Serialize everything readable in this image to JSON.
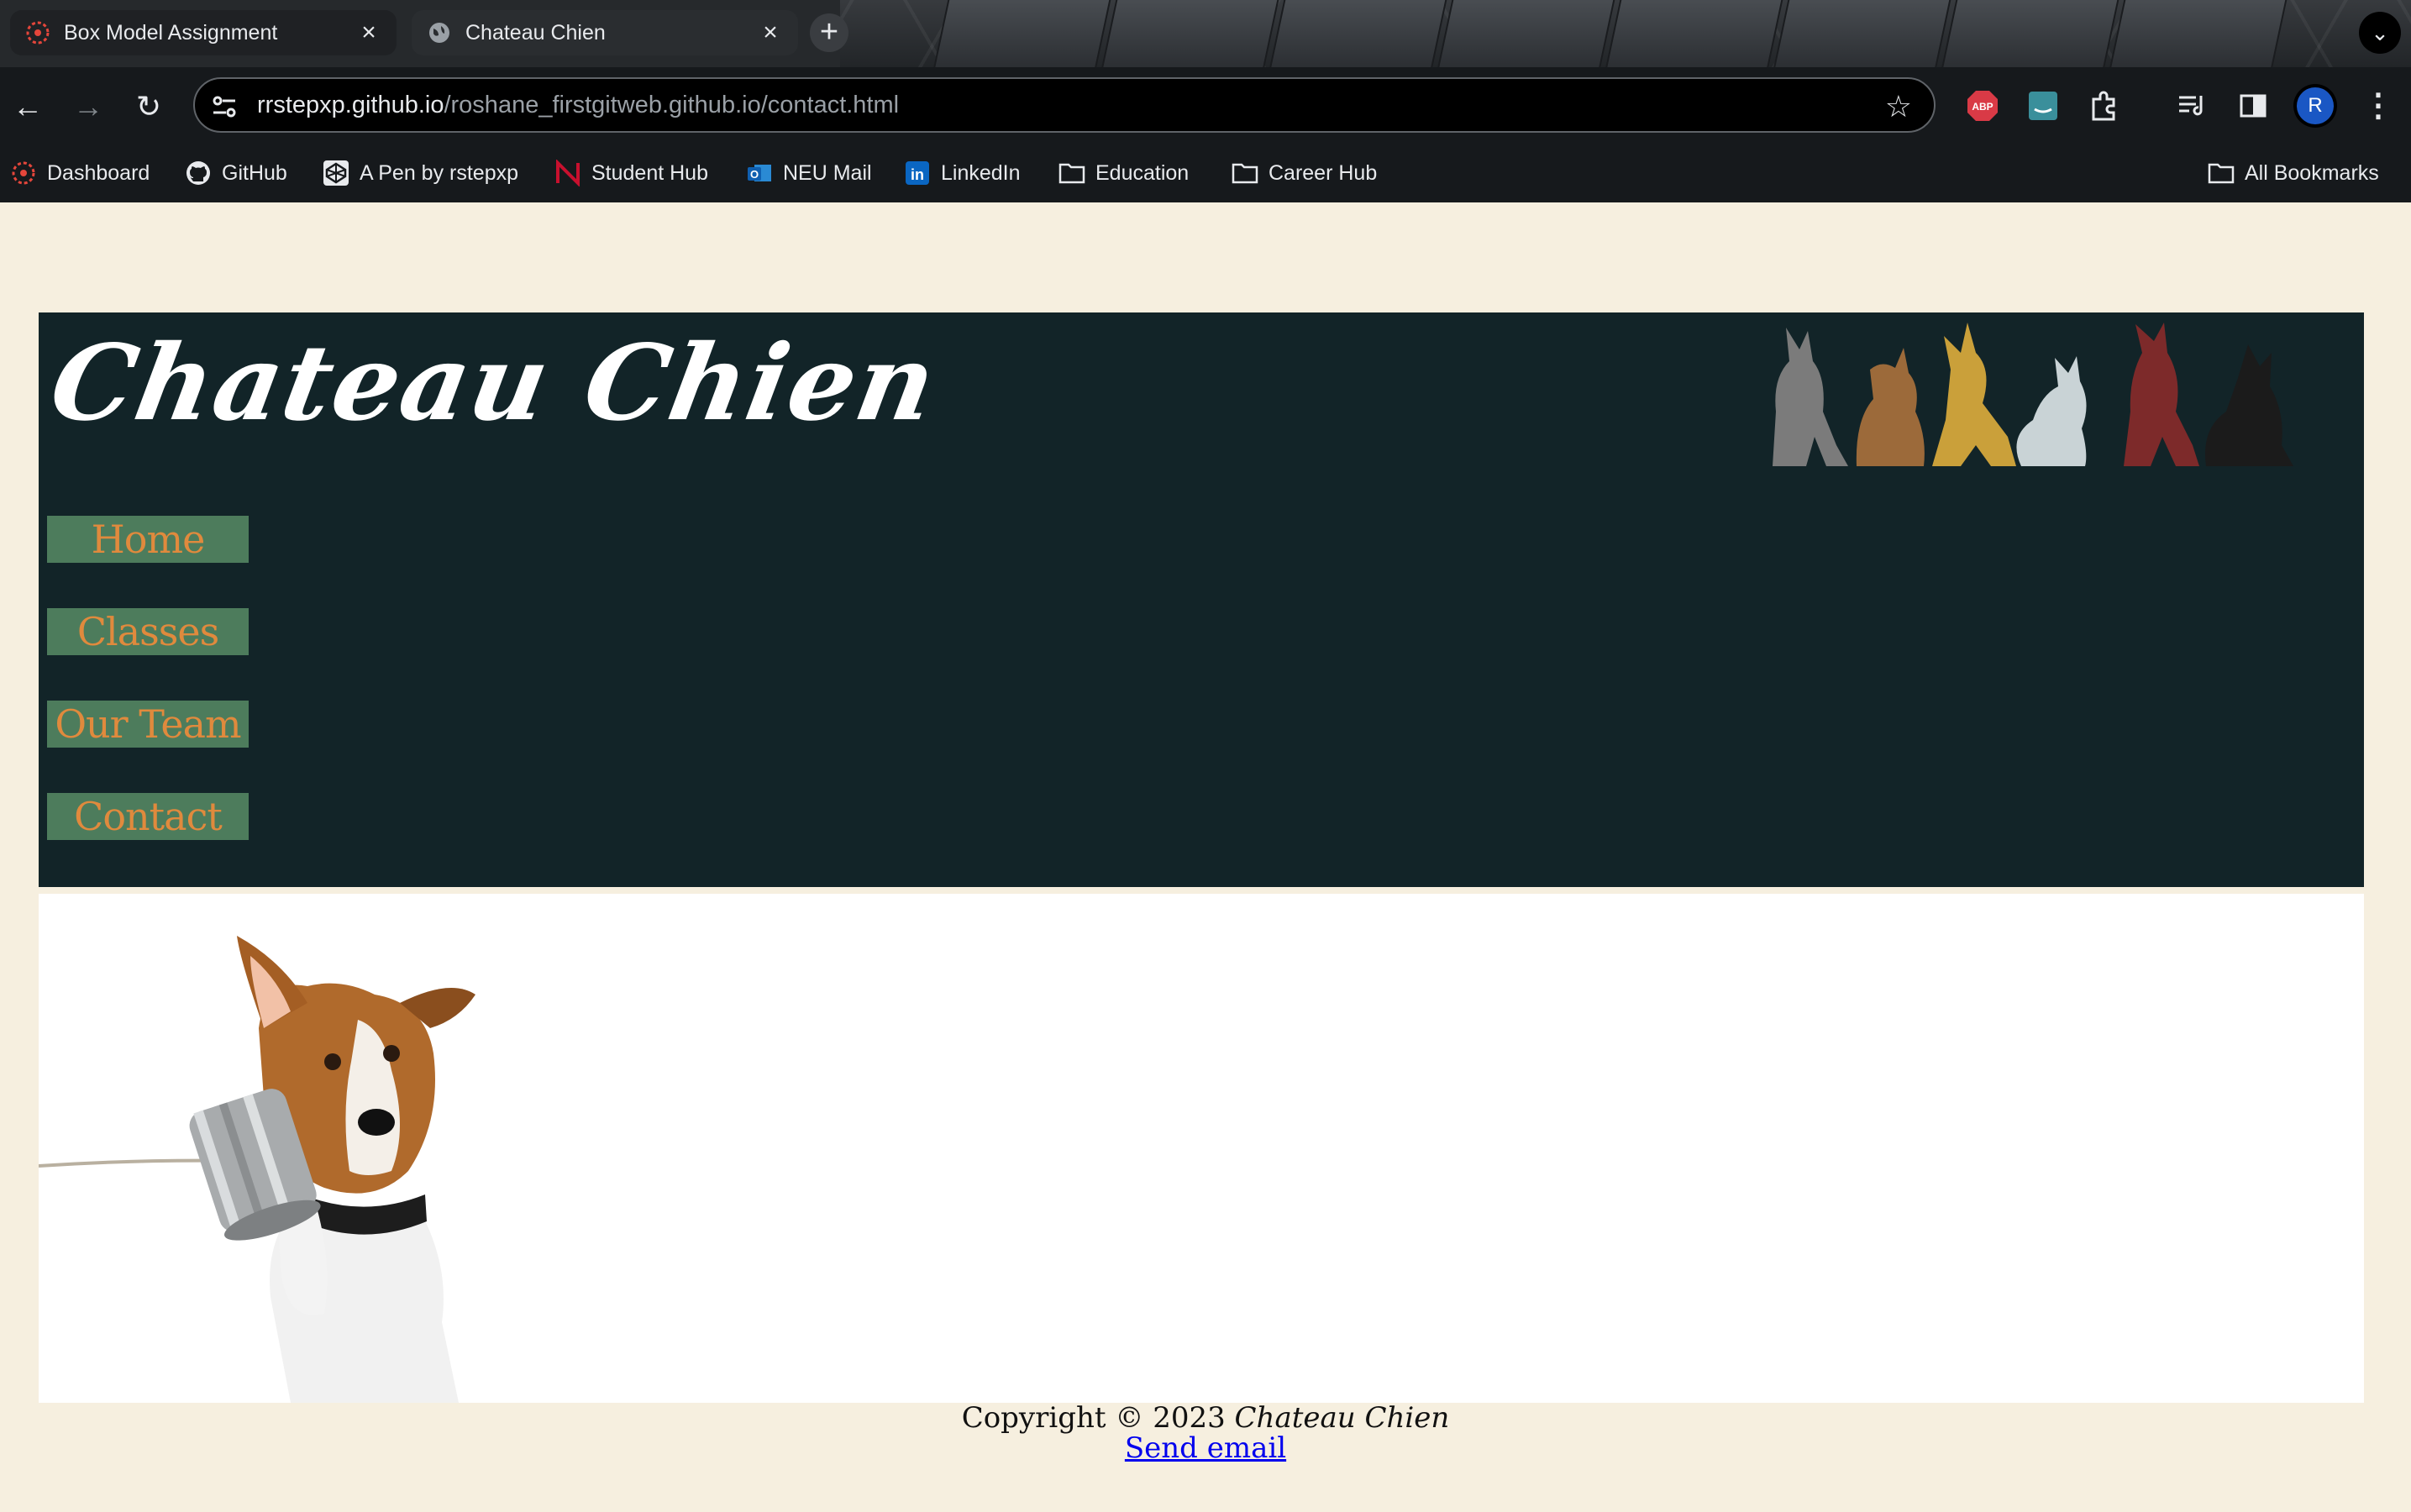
{
  "browser": {
    "tabs": [
      {
        "title": "Box Model Assignment",
        "active": false
      },
      {
        "title": "Chateau Chien",
        "active": true
      }
    ],
    "url": {
      "host": "rrstepxp.github.io",
      "path": "/roshane_firstgitweb.github.io/contact.html"
    },
    "avatar_initial": "R",
    "bookmarks": [
      {
        "label": "Dashboard",
        "icon": "canvas-icon"
      },
      {
        "label": "GitHub",
        "icon": "github-icon"
      },
      {
        "label": "A Pen by rstepxp",
        "icon": "codepen-icon"
      },
      {
        "label": "Student Hub",
        "icon": "northeastern-icon"
      },
      {
        "label": "NEU Mail",
        "icon": "outlook-icon"
      },
      {
        "label": "LinkedIn",
        "icon": "linkedin-icon"
      },
      {
        "label": "Education",
        "icon": "folder-icon"
      },
      {
        "label": "Career Hub",
        "icon": "folder-icon"
      }
    ],
    "all_bookmarks": "All Bookmarks"
  },
  "site": {
    "title": "Chateau Chien",
    "nav": [
      "Home",
      "Classes",
      "Our Team",
      "Contact"
    ],
    "footer": {
      "copyright_prefix": "Copyright © 2023 ",
      "copyright_name": "Chateau Chien",
      "email_link": "Send email"
    },
    "colors": {
      "header_bg": "#122428",
      "nav_bg": "#4d7c5c",
      "nav_text": "#e08a3d",
      "page_bg": "#f6efdf"
    }
  }
}
